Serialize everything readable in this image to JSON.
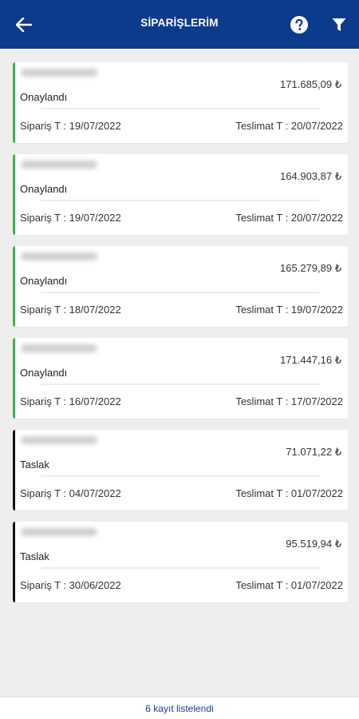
{
  "header": {
    "title": "SİPARİŞLERİM",
    "back_icon": "arrow-left-icon",
    "help_icon": "question-circle-icon",
    "filter_icon": "funnel-filter-icon",
    "background": "#0d3b8c"
  },
  "status_colors": {
    "approved": "#3bb54a",
    "draft": "#111111"
  },
  "orders": [
    {
      "amount": "171.685,09 ₺",
      "status": "Onaylandı",
      "order_date": "Sipariş T : 19/07/2022",
      "delivery_date": "Teslimat T : 20/07/2022"
    },
    {
      "amount": "164.903,87 ₺",
      "status": "Onaylandı",
      "order_date": "Sipariş T : 19/07/2022",
      "delivery_date": "Teslimat T : 20/07/2022"
    },
    {
      "amount": "165.279,89 ₺",
      "status": "Onaylandı",
      "order_date": "Sipariş T : 18/07/2022",
      "delivery_date": "Teslimat T : 19/07/2022"
    },
    {
      "amount": "171.447,16 ₺",
      "status": "Onaylandı",
      "order_date": "Sipariş T : 16/07/2022",
      "delivery_date": "Teslimat T : 17/07/2022"
    },
    {
      "amount": "71.071,22 ₺",
      "status": "Taslak",
      "order_date": "Sipariş T : 04/07/2022",
      "delivery_date": "Teslimat T : 01/07/2022"
    },
    {
      "amount": "95.519,94 ₺",
      "status": "Taslak",
      "order_date": "Sipariş T : 30/06/2022",
      "delivery_date": "Teslimat T : 01/07/2022"
    }
  ],
  "footer": {
    "text": "6 kayıt listelendi"
  }
}
